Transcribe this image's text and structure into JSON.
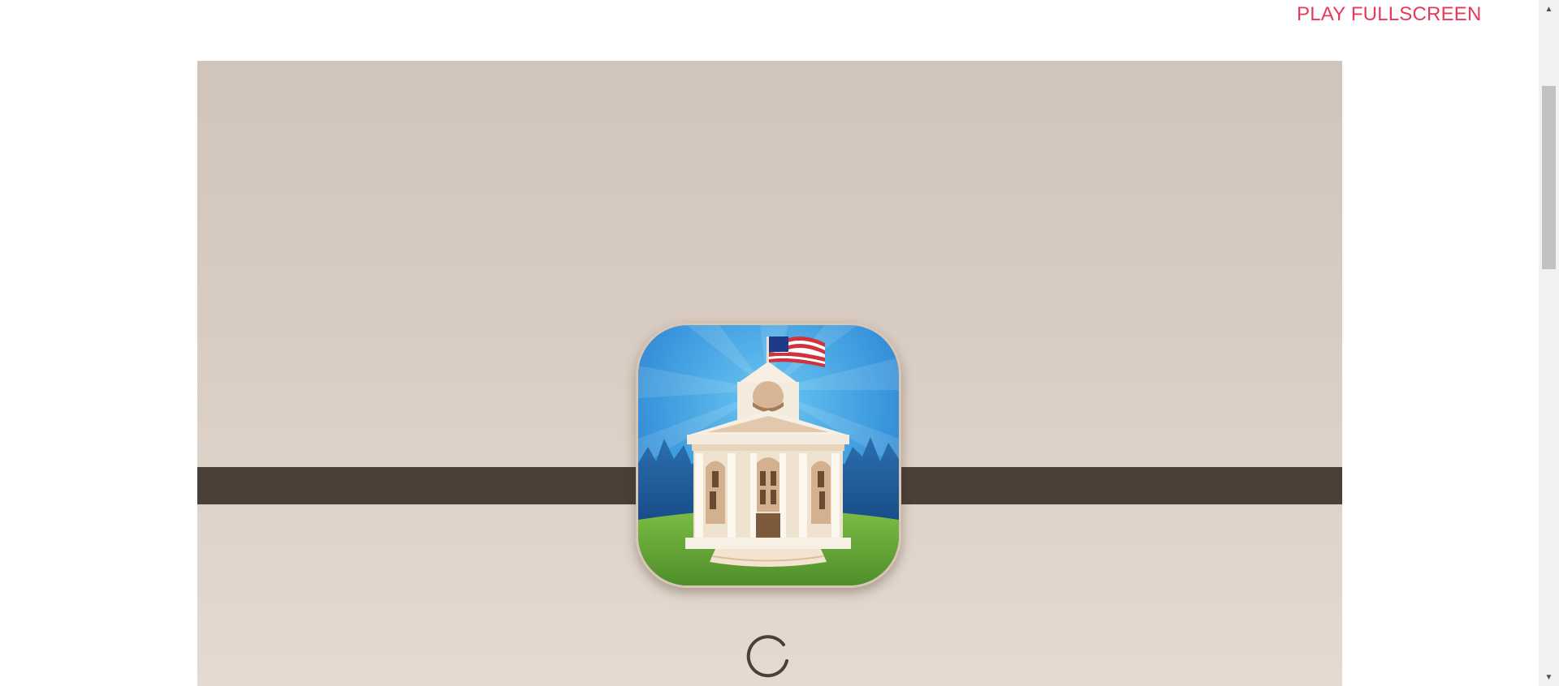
{
  "header": {
    "play_fullscreen_label": "PLAY FULLSCREEN"
  },
  "game": {
    "icon": "government-building-app-icon",
    "loading_indicator": "loading-spinner-icon"
  },
  "colors": {
    "accent_link": "#e8385d",
    "frame_background_top": "#d1c4ba",
    "frame_background_bottom": "#e4dad2",
    "stripe": "#4a4038",
    "icon_sky": "#3b9be0",
    "icon_grass": "#63a637"
  },
  "scrollbar": {
    "up_icon": "scroll-up-arrow-icon",
    "down_icon": "scroll-down-arrow-icon"
  }
}
